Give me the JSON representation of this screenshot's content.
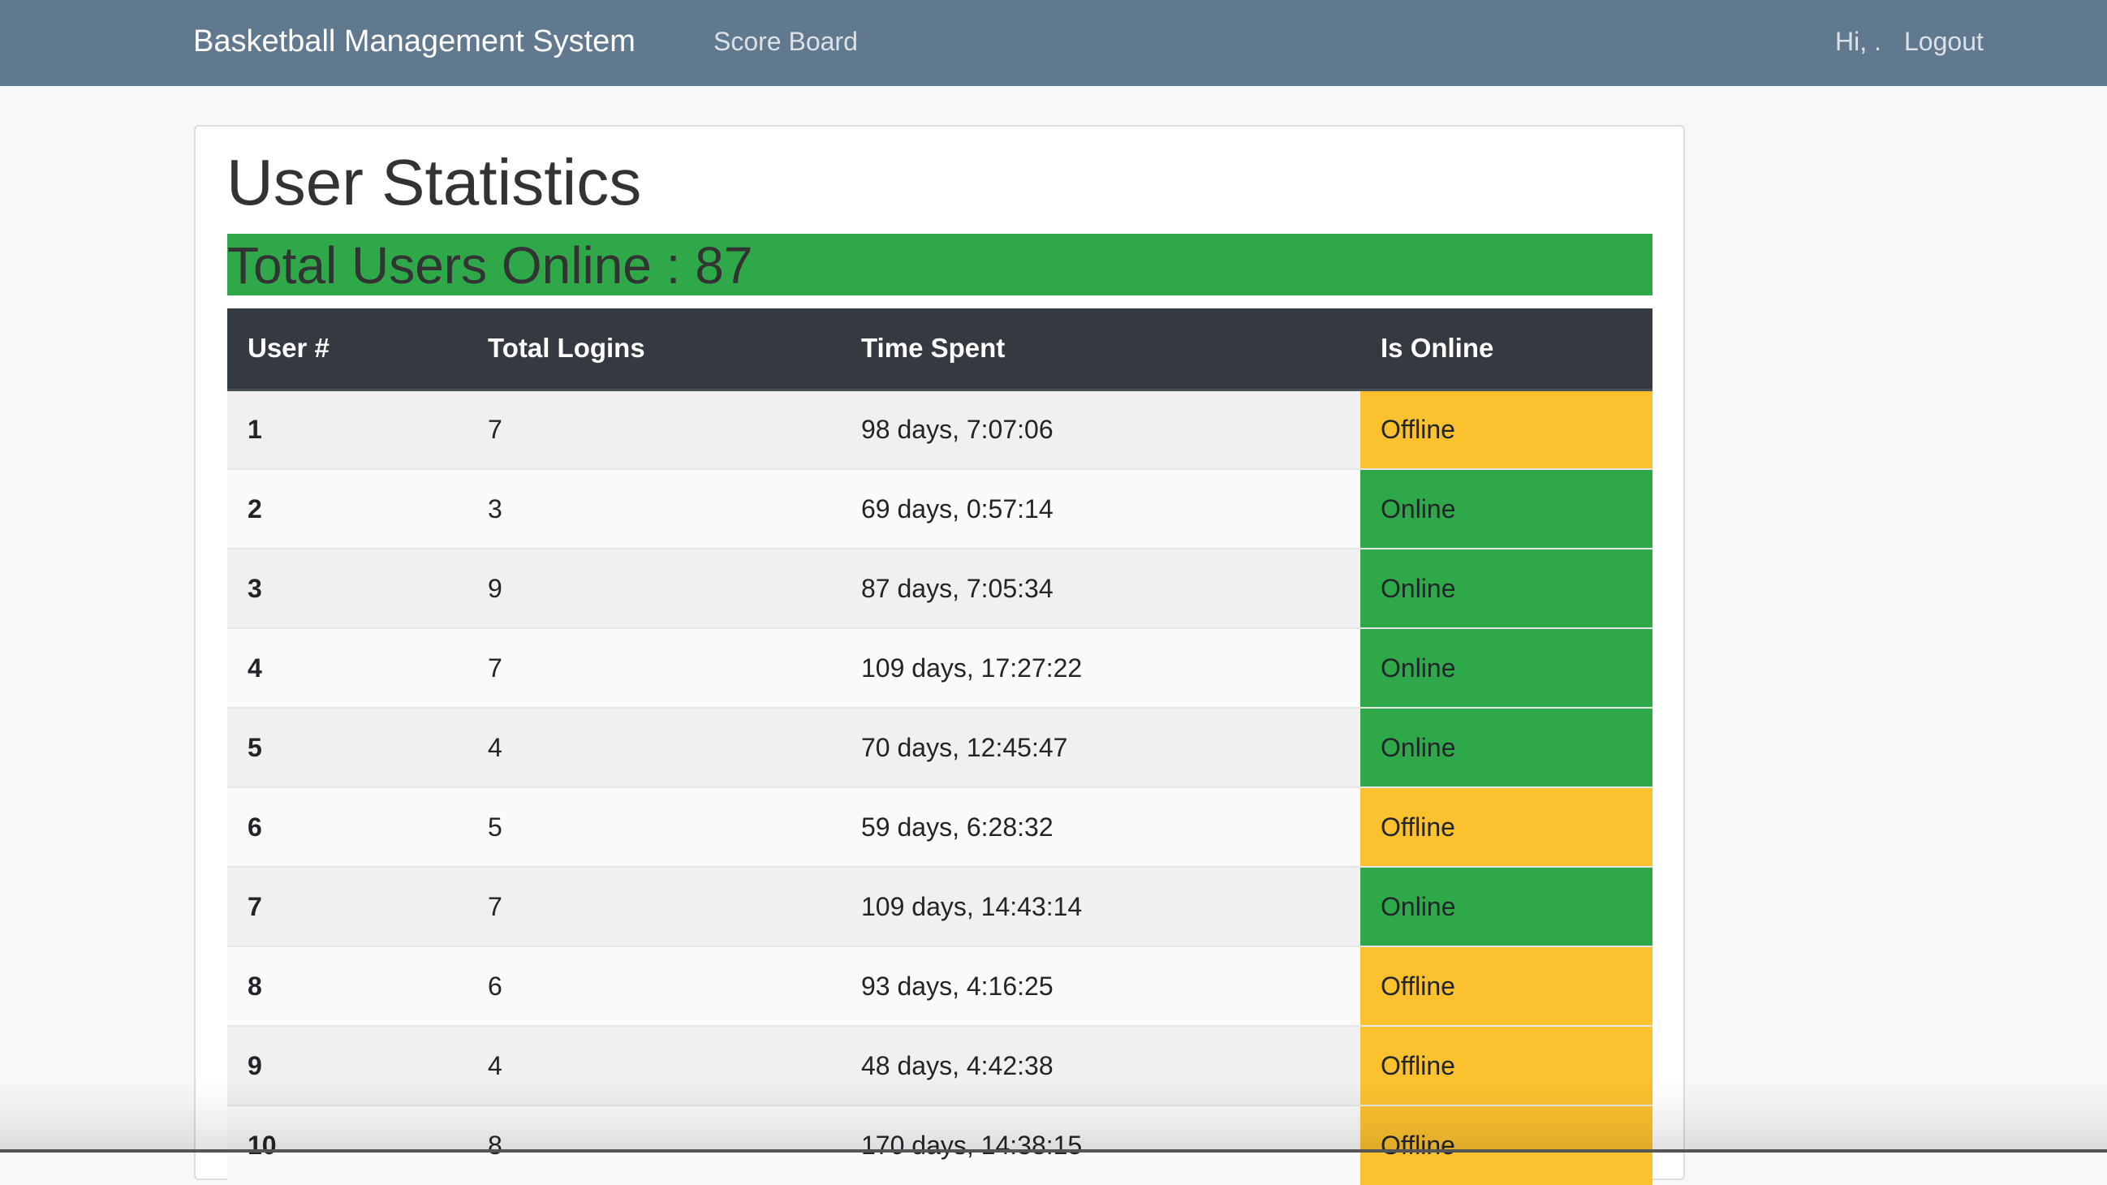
{
  "navbar": {
    "brand": "Basketball Management System",
    "links": {
      "score_board": "Score Board"
    },
    "greeting": "Hi, .",
    "logout": "Logout"
  },
  "page": {
    "title": "User Statistics",
    "online_banner": "Total Users Online : 87"
  },
  "colors": {
    "navbar": "#60798f",
    "online": "#2fa84a",
    "offline": "#fcc12e",
    "table_header": "#343a40"
  },
  "table": {
    "headers": [
      "User #",
      "Total Logins",
      "Time Spent",
      "Is Online"
    ],
    "rows": [
      {
        "user": "1",
        "logins": "7",
        "time": "98 days, 7:07:06",
        "status": "Offline"
      },
      {
        "user": "2",
        "logins": "3",
        "time": "69 days, 0:57:14",
        "status": "Online"
      },
      {
        "user": "3",
        "logins": "9",
        "time": "87 days, 7:05:34",
        "status": "Online"
      },
      {
        "user": "4",
        "logins": "7",
        "time": "109 days, 17:27:22",
        "status": "Online"
      },
      {
        "user": "5",
        "logins": "4",
        "time": "70 days, 12:45:47",
        "status": "Online"
      },
      {
        "user": "6",
        "logins": "5",
        "time": "59 days, 6:28:32",
        "status": "Offline"
      },
      {
        "user": "7",
        "logins": "7",
        "time": "109 days, 14:43:14",
        "status": "Online"
      },
      {
        "user": "8",
        "logins": "6",
        "time": "93 days, 4:16:25",
        "status": "Offline"
      },
      {
        "user": "9",
        "logins": "4",
        "time": "48 days, 4:42:38",
        "status": "Offline"
      },
      {
        "user": "10",
        "logins": "8",
        "time": "170 days, 14:38:15",
        "status": "Offline"
      }
    ]
  }
}
